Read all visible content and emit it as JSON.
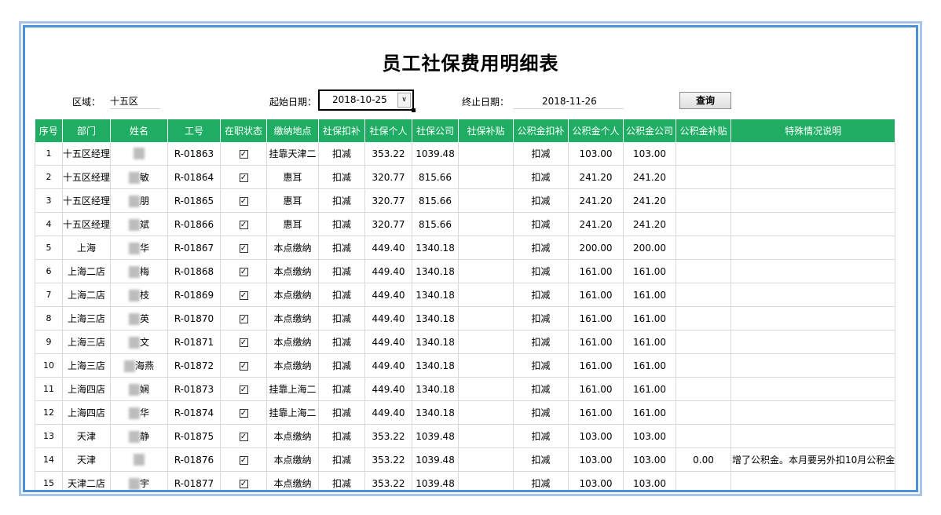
{
  "title": "员工社保费用明细表",
  "filters": {
    "region_label": "区域：",
    "region_value": "十五区",
    "start_label": "起始日期：",
    "start_value": "2018-10-25",
    "end_label": "终止日期：",
    "end_value": "2018-11-26",
    "query_label": "查询"
  },
  "columns": [
    "序号",
    "部门",
    "姓名",
    "工号",
    "在职状态",
    "缴纳地点",
    "社保扣补",
    "社保个人",
    "社保公司",
    "社保补贴",
    "公积金扣补",
    "公积金个人",
    "公积金公司",
    "公积金补贴",
    "特殊情况说明"
  ],
  "rows": [
    {
      "no": "1",
      "dept": "十五区经理",
      "name_visible": "",
      "id": "R-01863",
      "active": true,
      "location": "挂靠天津二",
      "ss_adj": "扣减",
      "ss_personal": "353.22",
      "ss_company": "1039.48",
      "ss_subsidy": "",
      "hf_adj": "扣减",
      "hf_personal": "103.00",
      "hf_company": "103.00",
      "hf_subsidy": "",
      "note": ""
    },
    {
      "no": "2",
      "dept": "十五区经理",
      "name_visible": "敏",
      "id": "R-01864",
      "active": true,
      "location": "惠耳",
      "ss_adj": "扣减",
      "ss_personal": "320.77",
      "ss_company": "815.66",
      "ss_subsidy": "",
      "hf_adj": "扣减",
      "hf_personal": "241.20",
      "hf_company": "241.20",
      "hf_subsidy": "",
      "note": ""
    },
    {
      "no": "3",
      "dept": "十五区经理",
      "name_visible": "朋",
      "id": "R-01865",
      "active": true,
      "location": "惠耳",
      "ss_adj": "扣减",
      "ss_personal": "320.77",
      "ss_company": "815.66",
      "ss_subsidy": "",
      "hf_adj": "扣减",
      "hf_personal": "241.20",
      "hf_company": "241.20",
      "hf_subsidy": "",
      "note": ""
    },
    {
      "no": "4",
      "dept": "十五区经理",
      "name_visible": "斌",
      "id": "R-01866",
      "active": true,
      "location": "惠耳",
      "ss_adj": "扣减",
      "ss_personal": "320.77",
      "ss_company": "815.66",
      "ss_subsidy": "",
      "hf_adj": "扣减",
      "hf_personal": "241.20",
      "hf_company": "241.20",
      "hf_subsidy": "",
      "note": ""
    },
    {
      "no": "5",
      "dept": "上海",
      "name_visible": "华",
      "id": "R-01867",
      "active": true,
      "location": "本点缴纳",
      "ss_adj": "扣减",
      "ss_personal": "449.40",
      "ss_company": "1340.18",
      "ss_subsidy": "",
      "hf_adj": "扣减",
      "hf_personal": "200.00",
      "hf_company": "200.00",
      "hf_subsidy": "",
      "note": ""
    },
    {
      "no": "6",
      "dept": "上海二店",
      "name_visible": "梅",
      "id": "R-01868",
      "active": true,
      "location": "本点缴纳",
      "ss_adj": "扣减",
      "ss_personal": "449.40",
      "ss_company": "1340.18",
      "ss_subsidy": "",
      "hf_adj": "扣减",
      "hf_personal": "161.00",
      "hf_company": "161.00",
      "hf_subsidy": "",
      "note": ""
    },
    {
      "no": "7",
      "dept": "上海二店",
      "name_visible": "枝",
      "id": "R-01869",
      "active": true,
      "location": "本点缴纳",
      "ss_adj": "扣减",
      "ss_personal": "449.40",
      "ss_company": "1340.18",
      "ss_subsidy": "",
      "hf_adj": "扣减",
      "hf_personal": "161.00",
      "hf_company": "161.00",
      "hf_subsidy": "",
      "note": ""
    },
    {
      "no": "8",
      "dept": "上海三店",
      "name_visible": "英",
      "id": "R-01870",
      "active": true,
      "location": "本点缴纳",
      "ss_adj": "扣减",
      "ss_personal": "449.40",
      "ss_company": "1340.18",
      "ss_subsidy": "",
      "hf_adj": "扣减",
      "hf_personal": "161.00",
      "hf_company": "161.00",
      "hf_subsidy": "",
      "note": ""
    },
    {
      "no": "9",
      "dept": "上海三店",
      "name_visible": "文",
      "id": "R-01871",
      "active": true,
      "location": "本点缴纳",
      "ss_adj": "扣减",
      "ss_personal": "449.40",
      "ss_company": "1340.18",
      "ss_subsidy": "",
      "hf_adj": "扣减",
      "hf_personal": "161.00",
      "hf_company": "161.00",
      "hf_subsidy": "",
      "note": ""
    },
    {
      "no": "10",
      "dept": "上海三店",
      "name_visible": "海燕",
      "id": "R-01872",
      "active": true,
      "location": "本点缴纳",
      "ss_adj": "扣减",
      "ss_personal": "449.40",
      "ss_company": "1340.18",
      "ss_subsidy": "",
      "hf_adj": "扣减",
      "hf_personal": "161.00",
      "hf_company": "161.00",
      "hf_subsidy": "",
      "note": ""
    },
    {
      "no": "11",
      "dept": "上海四店",
      "name_visible": "娴",
      "id": "R-01873",
      "active": true,
      "location": "挂靠上海二",
      "ss_adj": "扣减",
      "ss_personal": "449.40",
      "ss_company": "1340.18",
      "ss_subsidy": "",
      "hf_adj": "扣减",
      "hf_personal": "161.00",
      "hf_company": "161.00",
      "hf_subsidy": "",
      "note": ""
    },
    {
      "no": "12",
      "dept": "上海四店",
      "name_visible": "华",
      "id": "R-01874",
      "active": true,
      "location": "挂靠上海二",
      "ss_adj": "扣减",
      "ss_personal": "449.40",
      "ss_company": "1340.18",
      "ss_subsidy": "",
      "hf_adj": "扣减",
      "hf_personal": "161.00",
      "hf_company": "161.00",
      "hf_subsidy": "",
      "note": ""
    },
    {
      "no": "13",
      "dept": "天津",
      "name_visible": "静",
      "id": "R-01875",
      "active": true,
      "location": "本点缴纳",
      "ss_adj": "扣减",
      "ss_personal": "353.22",
      "ss_company": "1039.48",
      "ss_subsidy": "",
      "hf_adj": "扣减",
      "hf_personal": "103.00",
      "hf_company": "103.00",
      "hf_subsidy": "",
      "note": ""
    },
    {
      "no": "14",
      "dept": "天津",
      "name_visible": "",
      "id": "R-01876",
      "active": true,
      "location": "本点缴纳",
      "ss_adj": "扣减",
      "ss_personal": "353.22",
      "ss_company": "1039.48",
      "ss_subsidy": "",
      "hf_adj": "扣减",
      "hf_personal": "103.00",
      "hf_company": "103.00",
      "hf_subsidy": "0.00",
      "note": "增了公积金。本月要另外扣10月公积金"
    },
    {
      "no": "15",
      "dept": "天津二店",
      "name_visible": "宇",
      "id": "R-01877",
      "active": true,
      "location": "本点缴纳",
      "ss_adj": "扣减",
      "ss_personal": "353.22",
      "ss_company": "1039.48",
      "ss_subsidy": "",
      "hf_adj": "扣减",
      "hf_personal": "103.00",
      "hf_company": "103.00",
      "hf_subsidy": "",
      "note": ""
    }
  ]
}
